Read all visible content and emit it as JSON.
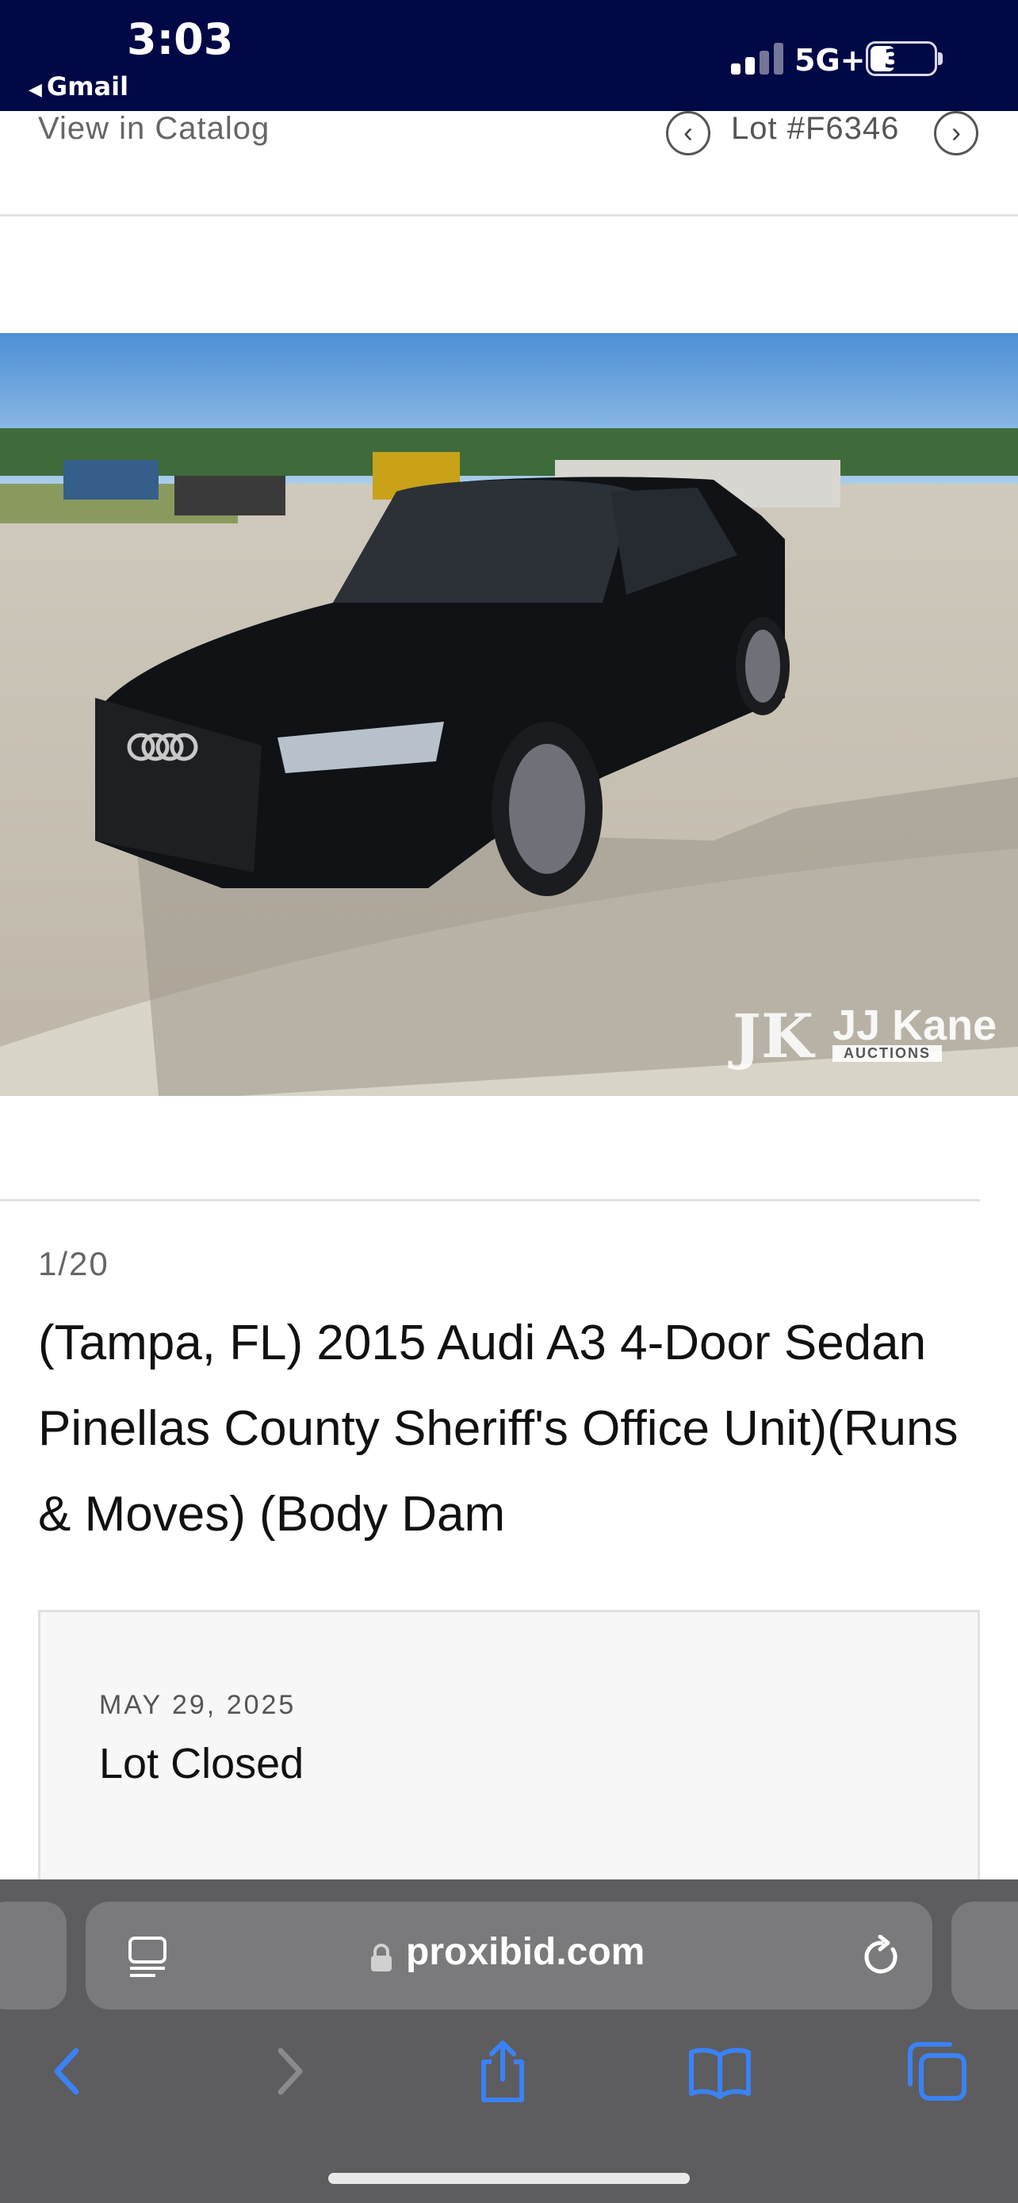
{
  "status_bar": {
    "time": "3:03",
    "back_app": "Gmail",
    "network": "5G+",
    "battery": "38",
    "battery_level": 0.38
  },
  "catalog": {
    "view_link": "View in Catalog",
    "lot_number": "Lot #F6346"
  },
  "photo": {
    "watermark_name": "JJ Kane",
    "watermark_sub": "AUCTIONS",
    "watermark_logo": "JK"
  },
  "lot": {
    "counter": "1/20",
    "title": "(Tampa, FL) 2015 Audi A3 4-Door Sedan Pinellas County Sheriff's Office Unit)(Runs & Moves) (Body Dam",
    "date": "MAY 29, 2025",
    "status": "Lot Closed"
  },
  "browser": {
    "url": "proxibid.com"
  },
  "colors": {
    "status_bar_bg": "#000845",
    "accent_blue": "#3b82f6",
    "safari_bg": "#5d5d5f"
  }
}
